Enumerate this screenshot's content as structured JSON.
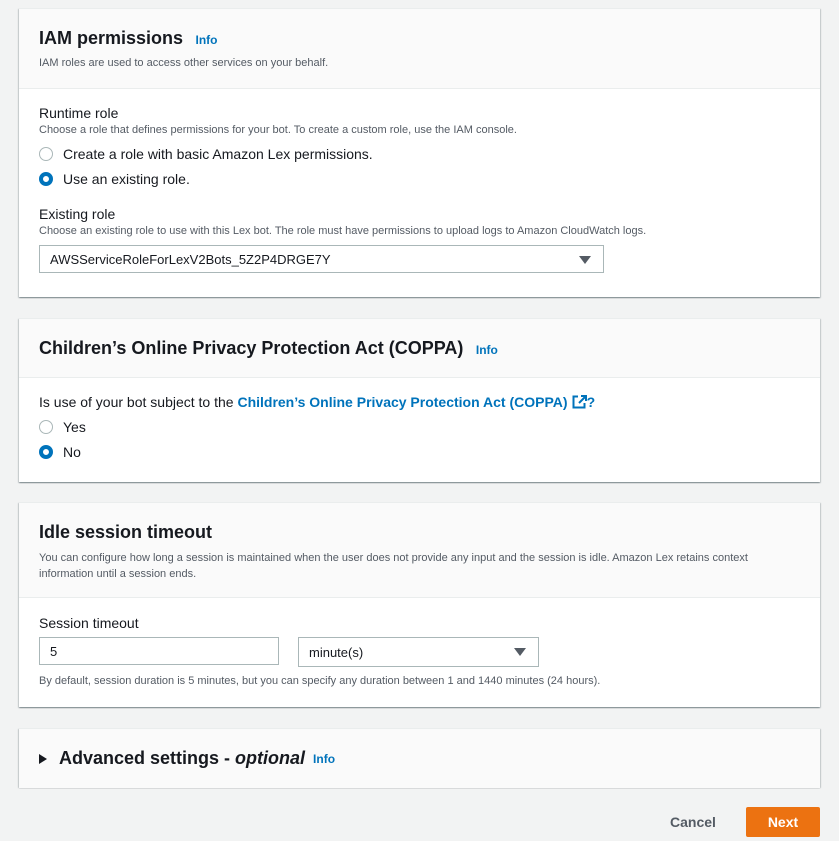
{
  "iam": {
    "title": "IAM permissions",
    "info": "Info",
    "description": "IAM roles are used to access other services on your behalf.",
    "runtime_role_label": "Runtime role",
    "runtime_role_desc": "Choose a role that defines permissions for your bot. To create a custom role, use the IAM console.",
    "options": [
      {
        "label": "Create a role with basic Amazon Lex permissions.",
        "checked": false
      },
      {
        "label": "Use an existing role.",
        "checked": true
      }
    ],
    "existing_role_label": "Existing role",
    "existing_role_desc": "Choose an existing role to use with this Lex bot. The role must have permissions to upload logs to Amazon CloudWatch logs.",
    "existing_role_value": "AWSServiceRoleForLexV2Bots_5Z2P4DRGE7Y"
  },
  "coppa": {
    "title": "Children’s Online Privacy Protection Act (COPPA)",
    "info": "Info",
    "question_prefix": "Is use of your bot subject to the ",
    "question_link": "Children’s Online Privacy Protection Act (COPPA)",
    "question_suffix": "?",
    "options": [
      {
        "label": "Yes",
        "checked": false
      },
      {
        "label": "No",
        "checked": true
      }
    ]
  },
  "idle": {
    "title": "Idle session timeout",
    "description": "You can configure how long a session is maintained when the user does not provide any input and the session is idle. Amazon Lex retains context information until a session ends.",
    "session_timeout_label": "Session timeout",
    "timeout_value": "5",
    "unit_value": "minute(s)",
    "hint": "By default, session duration is 5 minutes, but you can specify any duration between 1 and 1440 minutes (24 hours)."
  },
  "advanced": {
    "title": "Advanced settings",
    "title_suffix": "optional",
    "separator": " - ",
    "info": "Info"
  },
  "footer": {
    "cancel_label": "Cancel",
    "next_label": "Next"
  },
  "colors": {
    "link": "#0073bb",
    "primary_button": "#ec7211",
    "background": "#f2f3f3"
  }
}
